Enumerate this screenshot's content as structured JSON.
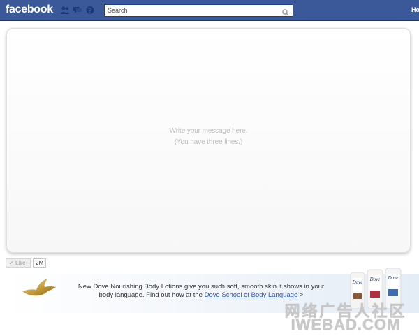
{
  "topbar": {
    "logo": "facebook",
    "search_placeholder": "Search",
    "home_link": "Ho"
  },
  "card": {
    "message_line1": "Write your message here.",
    "message_line2": "(You have three lines.)"
  },
  "like": {
    "label": "Like",
    "count": "2M"
  },
  "ad": {
    "text_before": "New Dove Nourishing Body Lotions give you such soft, smooth skin it shows in your body language. Find out how at the ",
    "link": "Dove School of Body Language",
    "text_after": " >",
    "bottle_brand": "Dove"
  },
  "watermark": {
    "cn": "网络广告人社区",
    "en": "IWEBAD.COM"
  },
  "colors": {
    "topbar": "#3b5998",
    "link": "#3b5998",
    "placeholder_text": "#bfbfbf"
  },
  "icons": [
    "friend-requests-icon",
    "messages-icon",
    "notifications-icon",
    "search-magnifier-icon",
    "dove-bird-logo",
    "like-check-icon"
  ]
}
